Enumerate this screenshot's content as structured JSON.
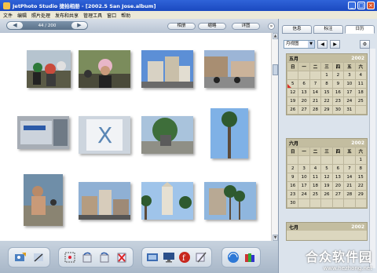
{
  "window": {
    "title": "JetPhoto Studio 捷拍相册 - [2002.5 San Jose.album]"
  },
  "menu": [
    "文件",
    "编辑",
    "照片处理",
    "发布和共享",
    "管理工具",
    "窗口",
    "帮助"
  ],
  "toolbar": {
    "counter": "44 / 200",
    "views": [
      "相册",
      "缩略",
      "详图"
    ]
  },
  "panel": {
    "tabs": [
      "信息",
      "标注",
      "日历"
    ],
    "active_tab": "日历",
    "view_select": "月视图",
    "weekdays": [
      "日",
      "一",
      "二",
      "三",
      "四",
      "五",
      "六"
    ],
    "months": [
      {
        "name": "五月",
        "year": "2002",
        "rows": [
          [
            "",
            "",
            "",
            "1",
            "2",
            "3",
            "4"
          ],
          [
            "5",
            "6",
            "7",
            "8",
            "9",
            "10",
            "11"
          ],
          [
            "12",
            "13",
            "14",
            "15",
            "16",
            "17",
            "18"
          ],
          [
            "19",
            "20",
            "21",
            "22",
            "23",
            "24",
            "25"
          ],
          [
            "26",
            "27",
            "28",
            "29",
            "30",
            "31",
            ""
          ]
        ]
      },
      {
        "name": "六月",
        "year": "2002",
        "rows": [
          [
            "",
            "",
            "",
            "",
            "",
            "",
            "1"
          ],
          [
            "2",
            "3",
            "4",
            "5",
            "6",
            "7",
            "8"
          ],
          [
            "9",
            "10",
            "11",
            "12",
            "13",
            "14",
            "15"
          ],
          [
            "16",
            "17",
            "18",
            "19",
            "20",
            "21",
            "22"
          ],
          [
            "23",
            "24",
            "25",
            "26",
            "27",
            "28",
            "29"
          ],
          [
            "30",
            "",
            "",
            "",
            "",
            "",
            ""
          ]
        ]
      },
      {
        "name": "七月",
        "year": "2002"
      }
    ]
  },
  "watermark": {
    "brand": "合众软件园",
    "url": "www.hezhong.net"
  }
}
